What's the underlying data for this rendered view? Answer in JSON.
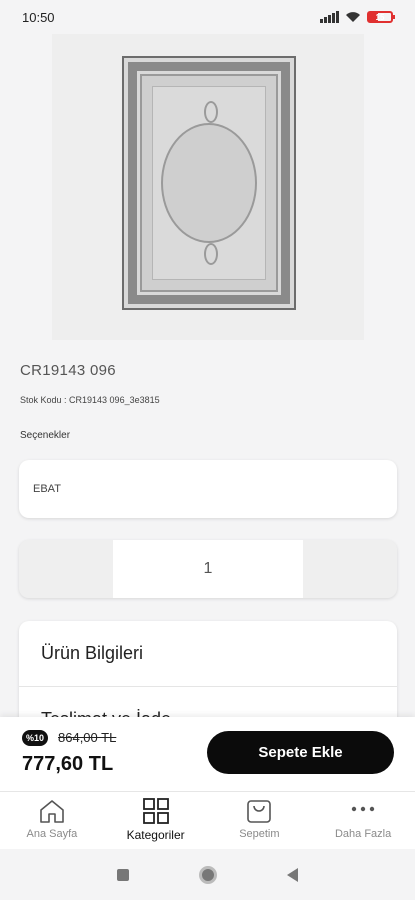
{
  "status_bar": {
    "time": "10:50",
    "battery_level": "15",
    "icons": [
      "signal-icon",
      "wifi-icon",
      "battery-icon"
    ]
  },
  "product": {
    "title": "CR19143 096",
    "stock_code": "Stok Kodu : CR19143 096_3e3815",
    "options_label": "Seçenekler",
    "size_placeholder": "EBAT",
    "quantity": "1"
  },
  "info_sections": [
    "Ürün Bilgileri",
    "Teslimat ve İade"
  ],
  "purchase": {
    "discount_badge": "%10",
    "old_price": "864,00 TL",
    "new_price": "777,60 TL",
    "add_to_cart": "Sepete Ekle"
  },
  "bottom_nav": [
    {
      "label": "Ana Sayfa",
      "icon": "home-icon",
      "active": false
    },
    {
      "label": "Kategoriler",
      "icon": "grid-icon",
      "active": true
    },
    {
      "label": "Sepetim",
      "icon": "bag-icon",
      "active": false
    },
    {
      "label": "Daha Fazla",
      "icon": "more-icon",
      "active": false
    }
  ],
  "colors": {
    "primary_button": "#0b0b0b",
    "background": "#f4f4f5",
    "battery_low": "#e03030"
  }
}
